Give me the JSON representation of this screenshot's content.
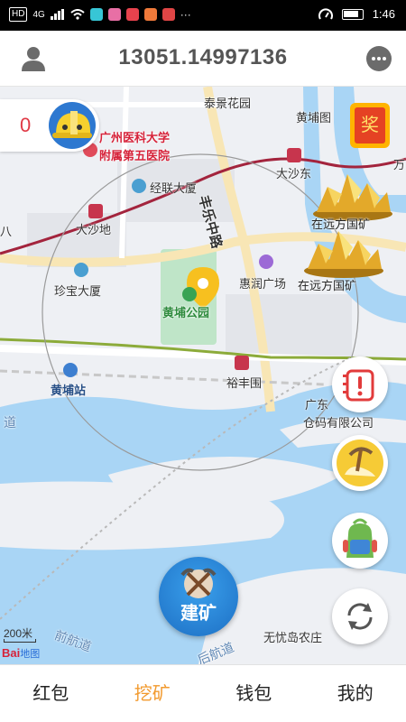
{
  "status_bar": {
    "left_chips": [
      "HD",
      "4G"
    ],
    "time": "1:46"
  },
  "header": {
    "title": "13051.14997136",
    "user_icon": "user-icon",
    "more_icon": "more-dots-icon"
  },
  "score": {
    "value": "0",
    "icon": "helmet-icon"
  },
  "award": {
    "label": "奖"
  },
  "map": {
    "labels": {
      "taijing": "泰景花园",
      "huangputu": "黄埔图",
      "wan": "万",
      "hospital_1": "广州医科大学",
      "hospital_2": "附属第五医院",
      "jinglian": "经联大厦",
      "fengle": "丰乐中路",
      "dashadong": "大沙东",
      "dashadi": "大沙地",
      "ba": "八",
      "zhenbao": "珍宝大厦",
      "huirun": "惠润广场",
      "park": "黄埔公园",
      "yufengwei": "裕丰围",
      "huangpu_station": "黄埔站",
      "guangdong": "广东",
      "warehouse": "仓码有限公司",
      "dao": "道",
      "qianhang": "前航道",
      "houhang": "后航道",
      "wuyou": "无忧岛农庄"
    },
    "scale": "200米",
    "logo_bai": "Bai",
    "logo_map": "地图"
  },
  "mines": [
    {
      "label": "在远方国矿"
    },
    {
      "label": "在远方国矿"
    }
  ],
  "fabs": {
    "notice": "notice-icon",
    "pickaxe": "pickaxe-icon",
    "backpack": "backpack-icon",
    "refresh": "refresh-icon"
  },
  "build_button": {
    "label": "建矿"
  },
  "tabs": [
    {
      "label": "红包",
      "active": false
    },
    {
      "label": "挖矿",
      "active": true
    },
    {
      "label": "钱包",
      "active": false
    },
    {
      "label": "我的",
      "active": false
    }
  ],
  "colors": {
    "tab_active": "#f29a2e",
    "score": "#e03a46",
    "water": "#a9d5f5",
    "build": "#1d6fc4"
  }
}
